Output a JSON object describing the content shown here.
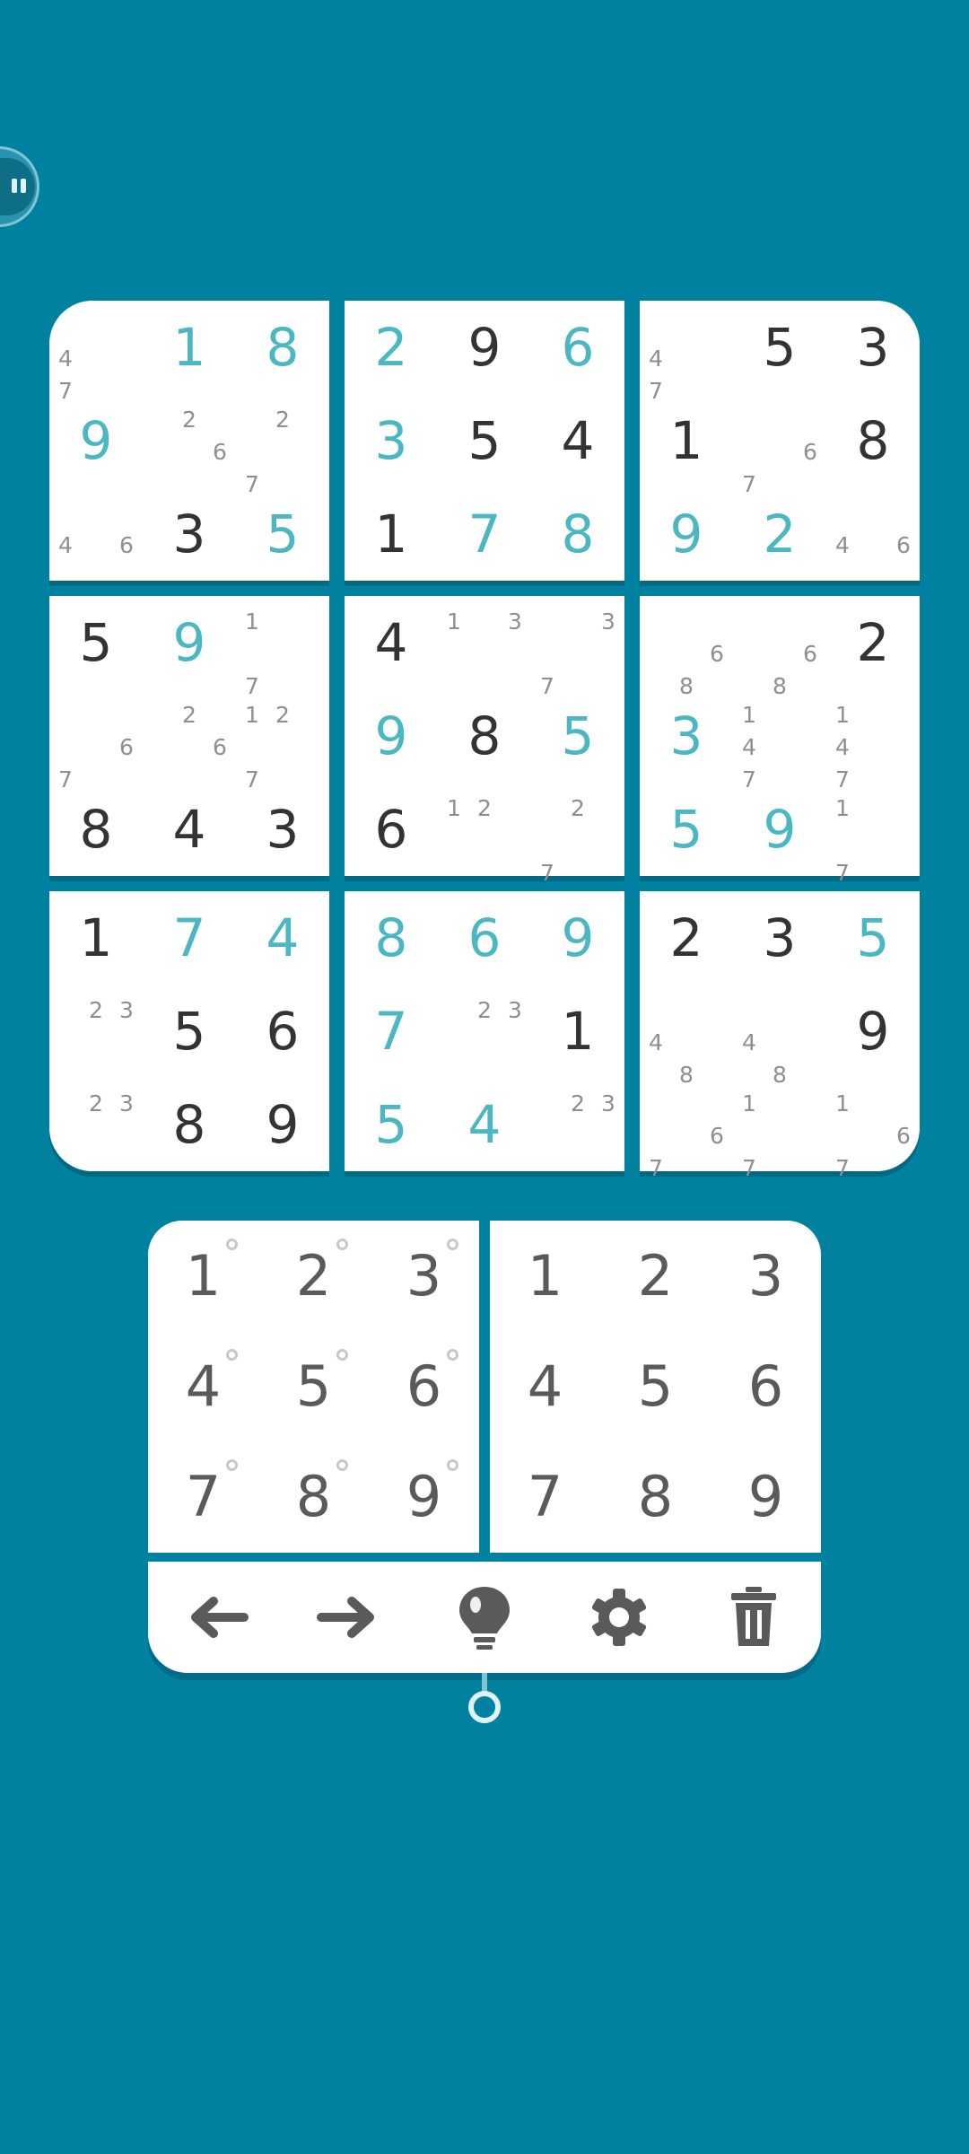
{
  "boxes": [
    [
      {
        "n": [
          4,
          7
        ]
      },
      {
        "v": "1",
        "t": "e"
      },
      {
        "v": "8",
        "t": "e"
      },
      {
        "v": "9",
        "t": "e"
      },
      {
        "n": [
          2,
          6
        ]
      },
      {
        "n": [
          2,
          7
        ]
      },
      {
        "n": [
          4,
          6
        ]
      },
      {
        "v": "3",
        "t": "g"
      },
      {
        "v": "5",
        "t": "e"
      }
    ],
    [
      {
        "v": "2",
        "t": "e"
      },
      {
        "v": "9",
        "t": "g"
      },
      {
        "v": "6",
        "t": "e"
      },
      {
        "v": "3",
        "t": "e"
      },
      {
        "v": "5",
        "t": "g"
      },
      {
        "v": "4",
        "t": "g"
      },
      {
        "v": "1",
        "t": "g"
      },
      {
        "v": "7",
        "t": "e"
      },
      {
        "v": "8",
        "t": "e"
      }
    ],
    [
      {
        "n": [
          4,
          7
        ]
      },
      {
        "v": "5",
        "t": "g"
      },
      {
        "v": "3",
        "t": "g"
      },
      {
        "v": "1",
        "t": "g"
      },
      {
        "n": [
          6,
          7
        ]
      },
      {
        "v": "8",
        "t": "g"
      },
      {
        "v": "9",
        "t": "e"
      },
      {
        "v": "2",
        "t": "e"
      },
      {
        "n": [
          4,
          6
        ]
      }
    ],
    [
      {
        "v": "5",
        "t": "g"
      },
      {
        "v": "9",
        "t": "e"
      },
      {
        "n": [
          1,
          7
        ]
      },
      {
        "n": [
          6,
          7
        ]
      },
      {
        "n": [
          2,
          6
        ]
      },
      {
        "n": [
          1,
          2,
          7
        ]
      },
      {
        "v": "8",
        "t": "g"
      },
      {
        "v": "4",
        "t": "g"
      },
      {
        "v": "3",
        "t": "g"
      }
    ],
    [
      {
        "v": "4",
        "t": "g"
      },
      {
        "n": [
          1,
          3
        ]
      },
      {
        "n": [
          3,
          7
        ]
      },
      {
        "v": "9",
        "t": "e"
      },
      {
        "v": "8",
        "t": "g"
      },
      {
        "v": "5",
        "t": "e"
      },
      {
        "v": "6",
        "t": "g"
      },
      {
        "n": [
          1,
          2
        ]
      },
      {
        "n": [
          2,
          7
        ]
      }
    ],
    [
      {
        "n": [
          6,
          8
        ]
      },
      {
        "n": [
          6,
          8
        ]
      },
      {
        "v": "2",
        "t": "g"
      },
      {
        "v": "3",
        "t": "e"
      },
      {
        "n": [
          1,
          4,
          7
        ]
      },
      {
        "n": [
          1,
          4,
          7
        ]
      },
      {
        "v": "5",
        "t": "e"
      },
      {
        "v": "9",
        "t": "e"
      },
      {
        "n": [
          1,
          7
        ]
      }
    ],
    [
      {
        "v": "1",
        "t": "g"
      },
      {
        "v": "7",
        "t": "e"
      },
      {
        "v": "4",
        "t": "e"
      },
      {
        "n": [
          2,
          3
        ]
      },
      {
        "v": "5",
        "t": "g"
      },
      {
        "v": "6",
        "t": "g"
      },
      {
        "n": [
          2,
          3
        ]
      },
      {
        "v": "8",
        "t": "g"
      },
      {
        "v": "9",
        "t": "g"
      }
    ],
    [
      {
        "v": "8",
        "t": "e"
      },
      {
        "v": "6",
        "t": "e"
      },
      {
        "v": "9",
        "t": "e"
      },
      {
        "v": "7",
        "t": "e"
      },
      {
        "n": [
          2,
          3
        ]
      },
      {
        "v": "1",
        "t": "g"
      },
      {
        "v": "5",
        "t": "e"
      },
      {
        "v": "4",
        "t": "e"
      },
      {
        "n": [
          2,
          3
        ]
      }
    ],
    [
      {
        "v": "2",
        "t": "g"
      },
      {
        "v": "3",
        "t": "g"
      },
      {
        "v": "5",
        "t": "e"
      },
      {
        "n": [
          4,
          8
        ]
      },
      {
        "n": [
          4,
          8
        ]
      },
      {
        "v": "9",
        "t": "g"
      },
      {
        "n": [
          6,
          7
        ]
      },
      {
        "n": [
          1,
          7
        ]
      },
      {
        "n": [
          1,
          6,
          7
        ]
      }
    ]
  ],
  "notes_keypad": [
    "1",
    "2",
    "3",
    "4",
    "5",
    "6",
    "7",
    "8",
    "9"
  ],
  "number_keypad": [
    "1",
    "2",
    "3",
    "4",
    "5",
    "6",
    "7",
    "8",
    "9"
  ],
  "toolbar": {
    "undo_icon": "arrow-left-icon",
    "redo_icon": "arrow-right-icon",
    "hint_icon": "lightbulb-icon",
    "settings_icon": "gear-icon",
    "delete_icon": "trash-icon"
  },
  "colors": {
    "background": "#0081a0",
    "given_digit": "#333333",
    "entered_digit": "#4ab7c3",
    "note_digit": "#8f8f8f",
    "keypad_digit": "#5a5a5a"
  }
}
